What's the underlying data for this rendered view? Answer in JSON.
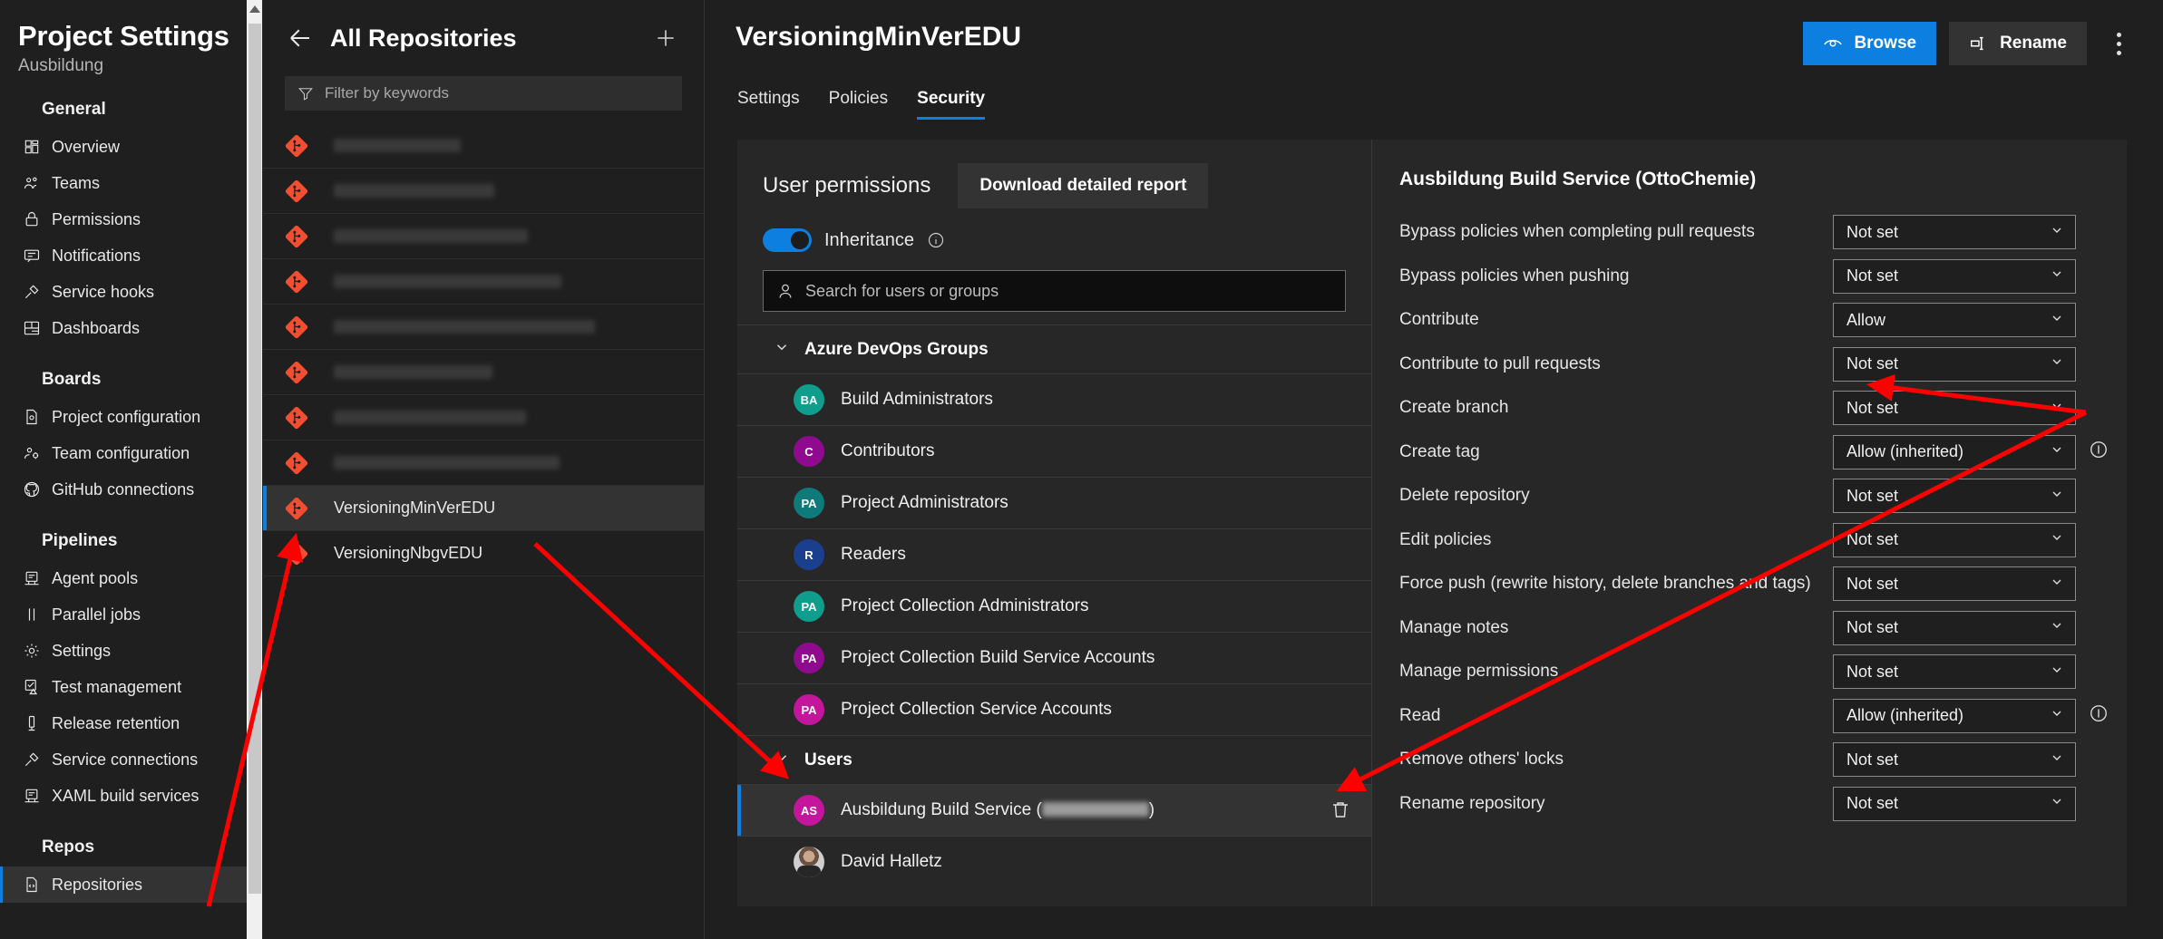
{
  "settings_nav": {
    "title": "Project Settings",
    "subtitle": "Ausbildung",
    "groups": [
      {
        "title": "General",
        "items": [
          {
            "label": "Overview",
            "icon": "overview-icon"
          },
          {
            "label": "Teams",
            "icon": "teams-icon"
          },
          {
            "label": "Permissions",
            "icon": "lock-icon"
          },
          {
            "label": "Notifications",
            "icon": "notifications-icon"
          },
          {
            "label": "Service hooks",
            "icon": "plug-icon"
          },
          {
            "label": "Dashboards",
            "icon": "dashboards-icon"
          }
        ]
      },
      {
        "title": "Boards",
        "items": [
          {
            "label": "Project configuration",
            "icon": "file-gear-icon"
          },
          {
            "label": "Team configuration",
            "icon": "people-gear-icon"
          },
          {
            "label": "GitHub connections",
            "icon": "github-icon"
          }
        ]
      },
      {
        "title": "Pipelines",
        "items": [
          {
            "label": "Agent pools",
            "icon": "server-icon"
          },
          {
            "label": "Parallel jobs",
            "icon": "parallel-icon"
          },
          {
            "label": "Settings",
            "icon": "gear-icon"
          },
          {
            "label": "Test management",
            "icon": "test-icon"
          },
          {
            "label": "Release retention",
            "icon": "retention-icon"
          },
          {
            "label": "Service connections",
            "icon": "plug-icon"
          },
          {
            "label": "XAML build services",
            "icon": "server-icon"
          }
        ]
      },
      {
        "title": "Repos",
        "items": [
          {
            "label": "Repositories",
            "icon": "repo-icon",
            "active": true
          }
        ]
      }
    ]
  },
  "repo_pane": {
    "title": "All Repositories",
    "back_label": "Back",
    "add_label": "New repository",
    "filter_placeholder": "Filter by keywords",
    "repos": [
      {
        "name": "",
        "redacted": true
      },
      {
        "name": "",
        "redacted": true
      },
      {
        "name": "",
        "redacted": true
      },
      {
        "name": "",
        "redacted": true
      },
      {
        "name": "",
        "redacted": true
      },
      {
        "name": "",
        "redacted": true
      },
      {
        "name": "",
        "redacted": true
      },
      {
        "name": "",
        "redacted": true
      },
      {
        "name": "VersioningMinVerEDU",
        "redacted": false,
        "selected": true
      },
      {
        "name": "VersioningNbgvEDU",
        "redacted": false
      }
    ]
  },
  "main": {
    "title": "VersioningMinVerEDU",
    "browse_label": "Browse",
    "rename_label": "Rename",
    "more_label": "More actions",
    "tabs": [
      {
        "label": "Settings",
        "active": false
      },
      {
        "label": "Policies",
        "active": false
      },
      {
        "label": "Security",
        "active": true
      }
    ]
  },
  "permissions": {
    "header_title": "User permissions",
    "report_button": "Download detailed report",
    "inheritance_label": "Inheritance",
    "inheritance_on": true,
    "search_placeholder": "Search for users or groups",
    "sections": [
      {
        "label": "Azure DevOps Groups",
        "expanded": true,
        "items": [
          {
            "name": "Build Administrators",
            "initials": "BA",
            "color": "#0f9d8e"
          },
          {
            "name": "Contributors",
            "initials": "C",
            "color": "#8f0a8f"
          },
          {
            "name": "Project Administrators",
            "initials": "PA",
            "color": "#0e7a7a"
          },
          {
            "name": "Readers",
            "initials": "R",
            "color": "#1b3f8f"
          },
          {
            "name": "Project Collection Administrators",
            "initials": "PA",
            "color": "#0f9d8e"
          },
          {
            "name": "Project Collection Build Service Accounts",
            "initials": "PA",
            "color": "#8f0a8f"
          },
          {
            "name": "Project Collection Service Accounts",
            "initials": "PA",
            "color": "#c4169c"
          }
        ]
      },
      {
        "label": "Users",
        "expanded": true,
        "items": [
          {
            "name": "Ausbildung Build Service (",
            "name_suffix": ")",
            "redacted_part": true,
            "initials": "AS",
            "color": "#c4169c",
            "selected": true,
            "has_delete": true
          },
          {
            "name": "David Halletz",
            "photo": true
          }
        ]
      }
    ],
    "subject": "Ausbildung Build Service (OttoChemie)",
    "rows": [
      {
        "label": "Bypass policies when completing pull requests",
        "value": "Not set",
        "inherited_mark": false
      },
      {
        "label": "Bypass policies when pushing",
        "value": "Not set",
        "inherited_mark": false
      },
      {
        "label": "Contribute",
        "value": "Allow",
        "inherited_mark": false
      },
      {
        "label": "Contribute to pull requests",
        "value": "Not set",
        "inherited_mark": false
      },
      {
        "label": "Create branch",
        "value": "Not set",
        "inherited_mark": false
      },
      {
        "label": "Create tag",
        "value": "Allow (inherited)",
        "inherited_mark": true
      },
      {
        "label": "Delete repository",
        "value": "Not set",
        "inherited_mark": false
      },
      {
        "label": "Edit policies",
        "value": "Not set",
        "inherited_mark": false
      },
      {
        "label": "Force push (rewrite history, delete branches and tags)",
        "value": "Not set",
        "inherited_mark": false
      },
      {
        "label": "Manage notes",
        "value": "Not set",
        "inherited_mark": false
      },
      {
        "label": "Manage permissions",
        "value": "Not set",
        "inherited_mark": false
      },
      {
        "label": "Read",
        "value": "Allow (inherited)",
        "inherited_mark": true
      },
      {
        "label": "Remove others' locks",
        "value": "Not set",
        "inherited_mark": false
      },
      {
        "label": "Rename repository",
        "value": "Not set",
        "inherited_mark": false
      }
    ]
  },
  "annotations": {
    "accent_color": "#ff0000",
    "arrow_count": 3
  }
}
